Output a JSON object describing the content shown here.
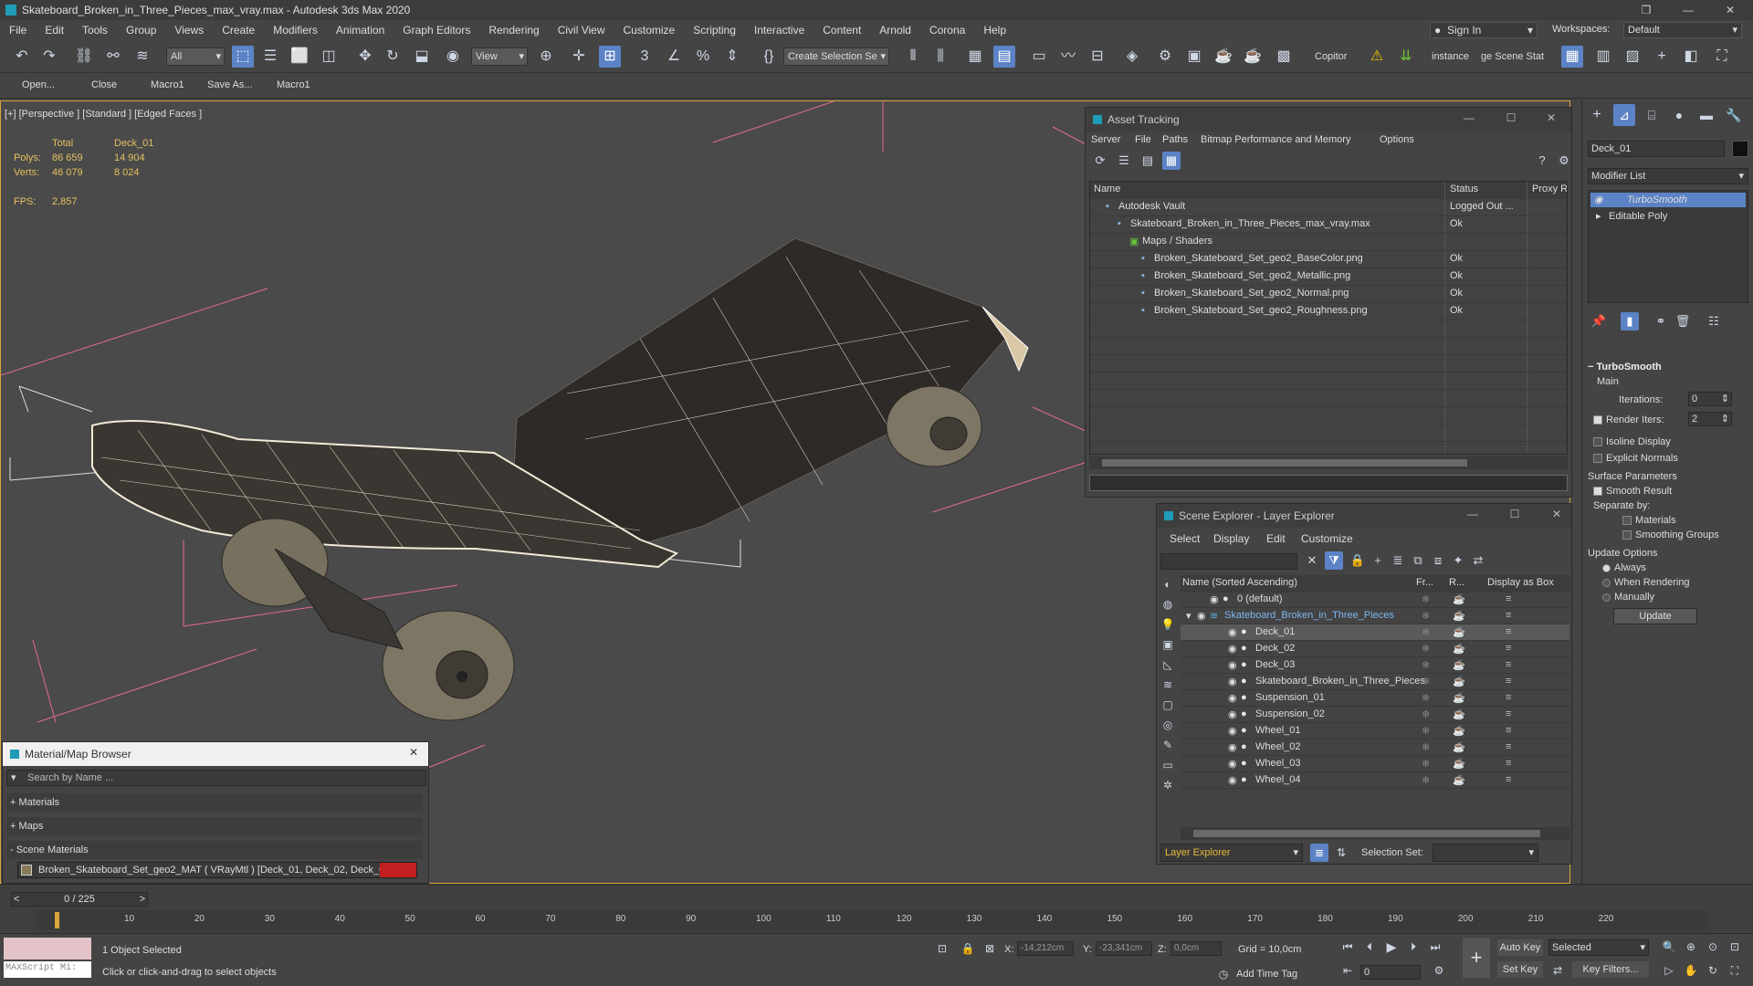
{
  "window": {
    "title": "Skateboard_Broken_in_Three_Pieces_max_vray.max - Autodesk 3ds Max 2020",
    "controls": {
      "minimize": "—",
      "restore": "❐",
      "close": "✕"
    }
  },
  "menu": [
    "File",
    "Edit",
    "Tools",
    "Group",
    "Views",
    "Create",
    "Modifiers",
    "Animation",
    "Graph Editors",
    "Rendering",
    "Civil View",
    "Customize",
    "Scripting",
    "Interactive",
    "Content",
    "Arnold",
    "Corona",
    "Help"
  ],
  "account": {
    "sign_in": "Sign In",
    "workspaces_label": "Workspaces:",
    "workspace": "Default"
  },
  "toolbar": {
    "filter": "All",
    "ref_coord": "View",
    "selection_set": "Create Selection Se",
    "copitor": "Copitor",
    "instance": "instance",
    "scene_stat": "ge Scene Stat"
  },
  "quickbar": [
    "Open...",
    "Close",
    "Macro1",
    "Save As...",
    "Macro1"
  ],
  "viewport": {
    "label": "[+] [Perspective ] [Standard ] [Edged Faces ]",
    "stats": {
      "col_total": "Total",
      "col_obj": "Deck_01",
      "polys_label": "Polys:",
      "polys_total": "86 659",
      "polys_obj": "14 904",
      "verts_label": "Verts:",
      "verts_total": "46 079",
      "verts_obj": "8 024",
      "fps_label": "FPS:",
      "fps": "2,857"
    }
  },
  "asset_tracking": {
    "title": "Asset Tracking",
    "menu": [
      "Server",
      "File",
      "Paths",
      "Bitmap Performance and Memory",
      "Options"
    ],
    "columns": [
      "Name",
      "Status",
      "Proxy R"
    ],
    "rows": [
      {
        "name": "Autodesk Vault",
        "status": "Logged Out ...",
        "indent": 1
      },
      {
        "name": "Skateboard_Broken_in_Three_Pieces_max_vray.max",
        "status": "Ok",
        "indent": 2
      },
      {
        "name": "Maps / Shaders",
        "status": "",
        "indent": 3
      },
      {
        "name": "Broken_Skateboard_Set_geo2_BaseColor.png",
        "status": "Ok",
        "indent": 4
      },
      {
        "name": "Broken_Skateboard_Set_geo2_Metallic.png",
        "status": "Ok",
        "indent": 4
      },
      {
        "name": "Broken_Skateboard_Set_geo2_Normal.png",
        "status": "Ok",
        "indent": 4
      },
      {
        "name": "Broken_Skateboard_Set_geo2_Roughness.png",
        "status": "Ok",
        "indent": 4
      }
    ]
  },
  "scene_explorer": {
    "title": "Scene Explorer - Layer Explorer",
    "menu": [
      "Select",
      "Display",
      "Edit",
      "Customize"
    ],
    "columns": [
      "Name (Sorted Ascending)",
      "Fr...",
      "R...",
      "Display as Box"
    ],
    "rows": [
      {
        "name": "0 (default)",
        "indent": 1,
        "selected": false
      },
      {
        "name": "Skateboard_Broken_in_Three_Pieces",
        "indent": 0,
        "selected": false,
        "layer": true
      },
      {
        "name": "Deck_01",
        "indent": 2,
        "selected": true
      },
      {
        "name": "Deck_02",
        "indent": 2,
        "selected": false
      },
      {
        "name": "Deck_03",
        "indent": 2,
        "selected": false
      },
      {
        "name": "Skateboard_Broken_in_Three_Pieces",
        "indent": 2,
        "selected": false
      },
      {
        "name": "Suspension_01",
        "indent": 2,
        "selected": false
      },
      {
        "name": "Suspension_02",
        "indent": 2,
        "selected": false
      },
      {
        "name": "Wheel_01",
        "indent": 2,
        "selected": false
      },
      {
        "name": "Wheel_02",
        "indent": 2,
        "selected": false
      },
      {
        "name": "Wheel_03",
        "indent": 2,
        "selected": false
      },
      {
        "name": "Wheel_04",
        "indent": 2,
        "selected": false
      }
    ],
    "footer_mode": "Layer Explorer",
    "selection_set_label": "Selection Set:"
  },
  "material_browser": {
    "title": "Material/Map Browser",
    "search_placeholder": "Search by Name ...",
    "groups": [
      "+ Materials",
      "+ Maps",
      "- Scene Materials"
    ],
    "scene_material": "Broken_Skateboard_Set_geo2_MAT ( VRayMtl ) [Deck_01, Deck_02, Deck_03,..."
  },
  "command_panel": {
    "object_name": "Deck_01",
    "modifier_list": "Modifier List",
    "stack": [
      "TurboSmooth",
      "Editable Poly"
    ],
    "rollout_title": "TurboSmooth",
    "main_label": "Main",
    "iterations_label": "Iterations:",
    "iterations": "0",
    "render_iters_label": "Render Iters:",
    "render_iters": "2",
    "isoline": "Isoline Display",
    "explicit_normals": "Explicit Normals",
    "surface_params": "Surface Parameters",
    "smooth_result": "Smooth Result",
    "separate_by": "Separate by:",
    "materials": "Materials",
    "smoothing_groups": "Smoothing Groups",
    "update_options": "Update Options",
    "always": "Always",
    "when_rendering": "When Rendering",
    "manually": "Manually",
    "update_btn": "Update"
  },
  "timeline": {
    "frame": "0 / 225",
    "ticks": [
      "10",
      "20",
      "30",
      "40",
      "50",
      "60",
      "70",
      "80",
      "90",
      "100",
      "110",
      "120",
      "130",
      "140",
      "150",
      "160",
      "170",
      "180",
      "190",
      "200",
      "210",
      "220"
    ]
  },
  "status": {
    "maxscript": "MAXScript Mi:",
    "selected": "1 Object Selected",
    "prompt": "Click or click-and-drag to select objects",
    "x_label": "X:",
    "x": "-14,212cm",
    "y_label": "Y:",
    "y": "-23,341cm",
    "z_label": "Z:",
    "z": "0,0cm",
    "grid": "Grid = 10,0cm",
    "add_time_tag": "Add Time Tag",
    "auto_key": "Auto Key",
    "set_key": "Set Key",
    "selected_dd": "Selected",
    "key_filters": "Key Filters...",
    "frame_field": "0"
  }
}
